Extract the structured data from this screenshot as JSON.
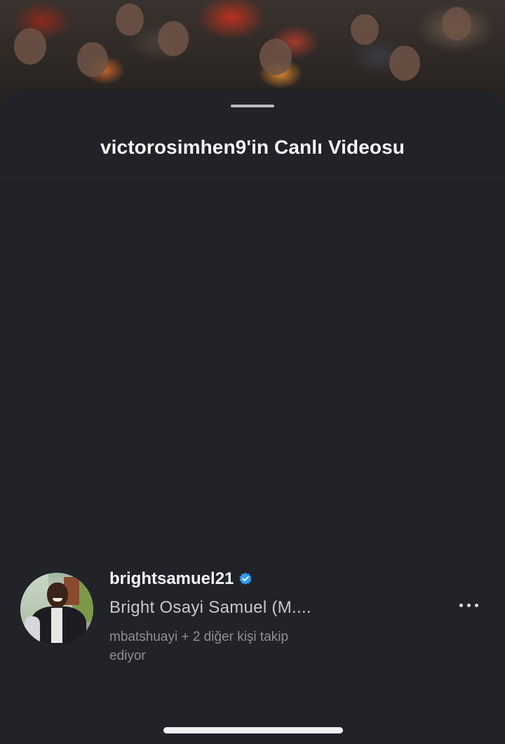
{
  "sheet": {
    "title": "victorosimhen9'in Canlı Videosu"
  },
  "profile": {
    "username": "brightsamuel21",
    "verified": true,
    "full_name": "Bright Osayi Samuel (M....",
    "followed_by": "mbatshuayi + 2 diğer kişi takip ediyor",
    "avatar_icon": "profile-photo"
  },
  "icons": {
    "verified": "verified-badge-icon",
    "more": "more-horizontal-icon"
  },
  "colors": {
    "sheet_background": "#212329",
    "verified_blue": "#2f9bf0",
    "primary_text": "#f5f5f5",
    "secondary_text": "#8e9096"
  }
}
